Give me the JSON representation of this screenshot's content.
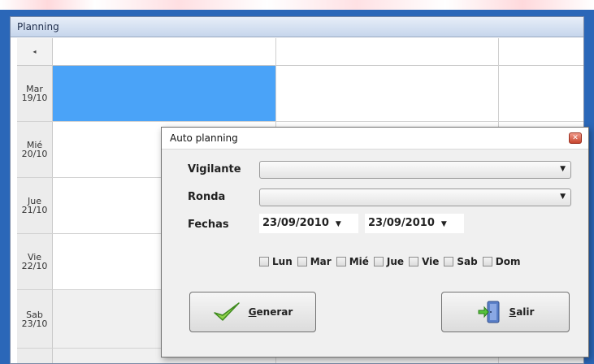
{
  "planning": {
    "title": "Planning",
    "header_arrow": "◂",
    "rows": [
      {
        "day": "Mar",
        "date": "19/10"
      },
      {
        "day": "Mié",
        "date": "20/10"
      },
      {
        "day": "Jue",
        "date": "21/10"
      },
      {
        "day": "Vie",
        "date": "22/10"
      },
      {
        "day": "Sab",
        "date": "23/10"
      }
    ]
  },
  "dialog": {
    "title": "Auto planning",
    "close_icon": "close-x",
    "vigilante_label": "Vigilante",
    "vigilante_value": "",
    "ronda_label": "Ronda",
    "ronda_value": "",
    "fechas_label": "Fechas",
    "date_from": "23/09/2010",
    "date_to": "23/09/2010",
    "days": [
      "Lun",
      "Mar",
      "Mié",
      "Jue",
      "Vie",
      "Sab",
      "Dom"
    ],
    "generar_first": "G",
    "generar_rest": "enerar",
    "salir_first": "S",
    "salir_rest": "alir"
  },
  "colors": {
    "selected_cell": "#4aa3f8",
    "frame_blue": "#2b67b8"
  }
}
